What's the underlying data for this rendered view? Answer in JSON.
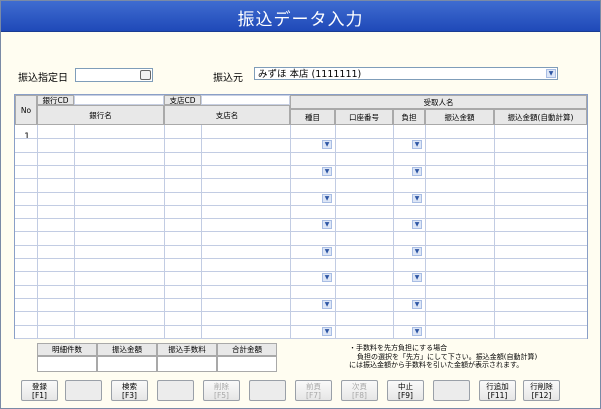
{
  "title": "振込データ入力",
  "form": {
    "date_label": "振込指定日",
    "date_value": "",
    "source_label": "振込元",
    "source_value": "みずほ 本店 (1111111)"
  },
  "grid": {
    "headers": {
      "no": "No",
      "bank_cd": "銀行CD",
      "bank_name": "銀行名",
      "branch_cd": "支店CD",
      "branch_name": "支店名",
      "recipient": "受取人名",
      "account_type": "種目",
      "account_number": "口座番号",
      "fee_bearer": "負担",
      "transfer_amount": "振込金額",
      "transfer_amount_auto": "振込金額(自動計算)"
    },
    "rows": [
      {
        "no": "1"
      }
    ],
    "row_count": 8
  },
  "summary": {
    "headers": [
      "明細件数",
      "振込金額",
      "振込手数料",
      "合計金額"
    ],
    "values": [
      "",
      "",
      "",
      ""
    ]
  },
  "note": {
    "line1": "・手数料を先方負担にする場合",
    "line2": "負担の選択を「先方」にして下さい。振込金額(自動計算)",
    "line3": "には振込金額から手数料を引いた金額が表示されます。"
  },
  "buttons": [
    {
      "l1": "登録",
      "l2": "[F1]",
      "state": "enabled"
    },
    {
      "l1": "",
      "l2": "",
      "state": "blank"
    },
    {
      "l1": "検索",
      "l2": "[F3]",
      "state": "enabled"
    },
    {
      "l1": "",
      "l2": "",
      "state": "blank"
    },
    {
      "l1": "削除",
      "l2": "[F5]",
      "state": "disabled"
    },
    {
      "l1": "",
      "l2": "",
      "state": "blank"
    },
    {
      "l1": "前頁",
      "l2": "[F7]",
      "state": "disabled"
    },
    {
      "l1": "次頁",
      "l2": "[F8]",
      "state": "disabled"
    },
    {
      "l1": "中止",
      "l2": "[F9]",
      "state": "enabled"
    },
    {
      "l1": "",
      "l2": "",
      "state": "blank"
    },
    {
      "l1": "行追加",
      "l2": "[F11]",
      "state": "enabled"
    },
    {
      "l1": "行削除",
      "l2": "[F12]",
      "state": "enabled"
    }
  ],
  "colors": {
    "title_bar": "#2a56c4",
    "form_background": "#fffdf1",
    "header_fill": "#e8e8e8"
  }
}
